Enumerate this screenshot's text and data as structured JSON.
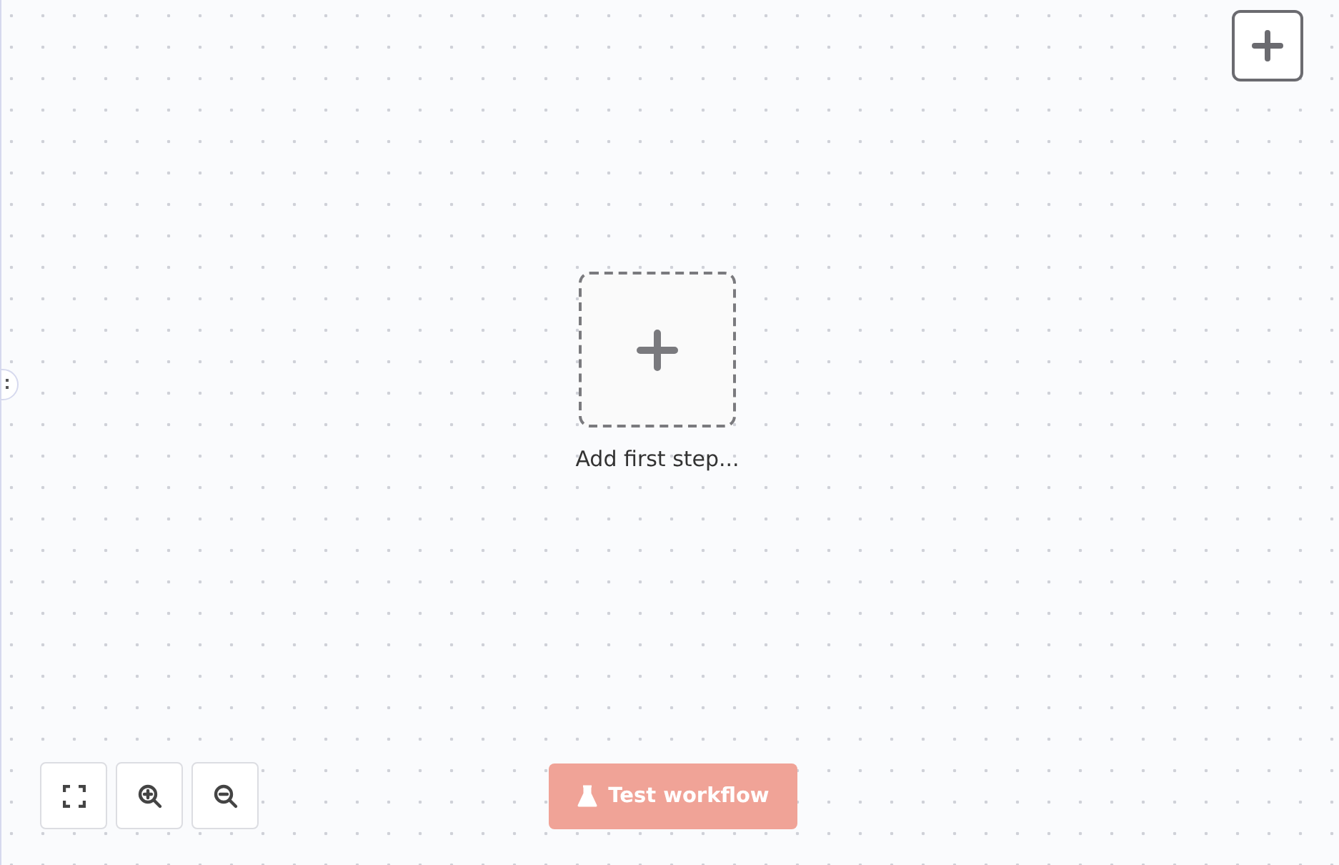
{
  "canvas": {
    "first_step": {
      "label": "Add first step..."
    }
  },
  "zoom_controls": [
    {
      "kind": "fit"
    },
    {
      "kind": "zoom_in"
    },
    {
      "kind": "zoom_out"
    }
  ],
  "test_button": {
    "label": "Test workflow",
    "disabled": true
  }
}
